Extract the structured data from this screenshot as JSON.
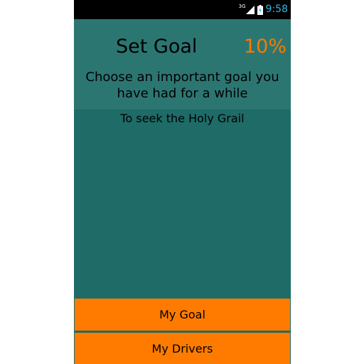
{
  "status_bar": {
    "network_type": "3G",
    "time": "9:58",
    "icons": [
      "signal-icon",
      "battery-charging-icon"
    ]
  },
  "header": {
    "title": "Set Goal",
    "progress": "10%",
    "instructions": "Choose an important goal you have had for a while"
  },
  "goal": {
    "text": "To seek the Holy Grail"
  },
  "buttons": {
    "my_goal": "My Goal",
    "my_drivers": "My Drivers"
  },
  "colors": {
    "header_bg": "#2c7672",
    "body_bg": "#1e6b68",
    "accent": "#ff7b00",
    "clock": "#33b5e5"
  }
}
